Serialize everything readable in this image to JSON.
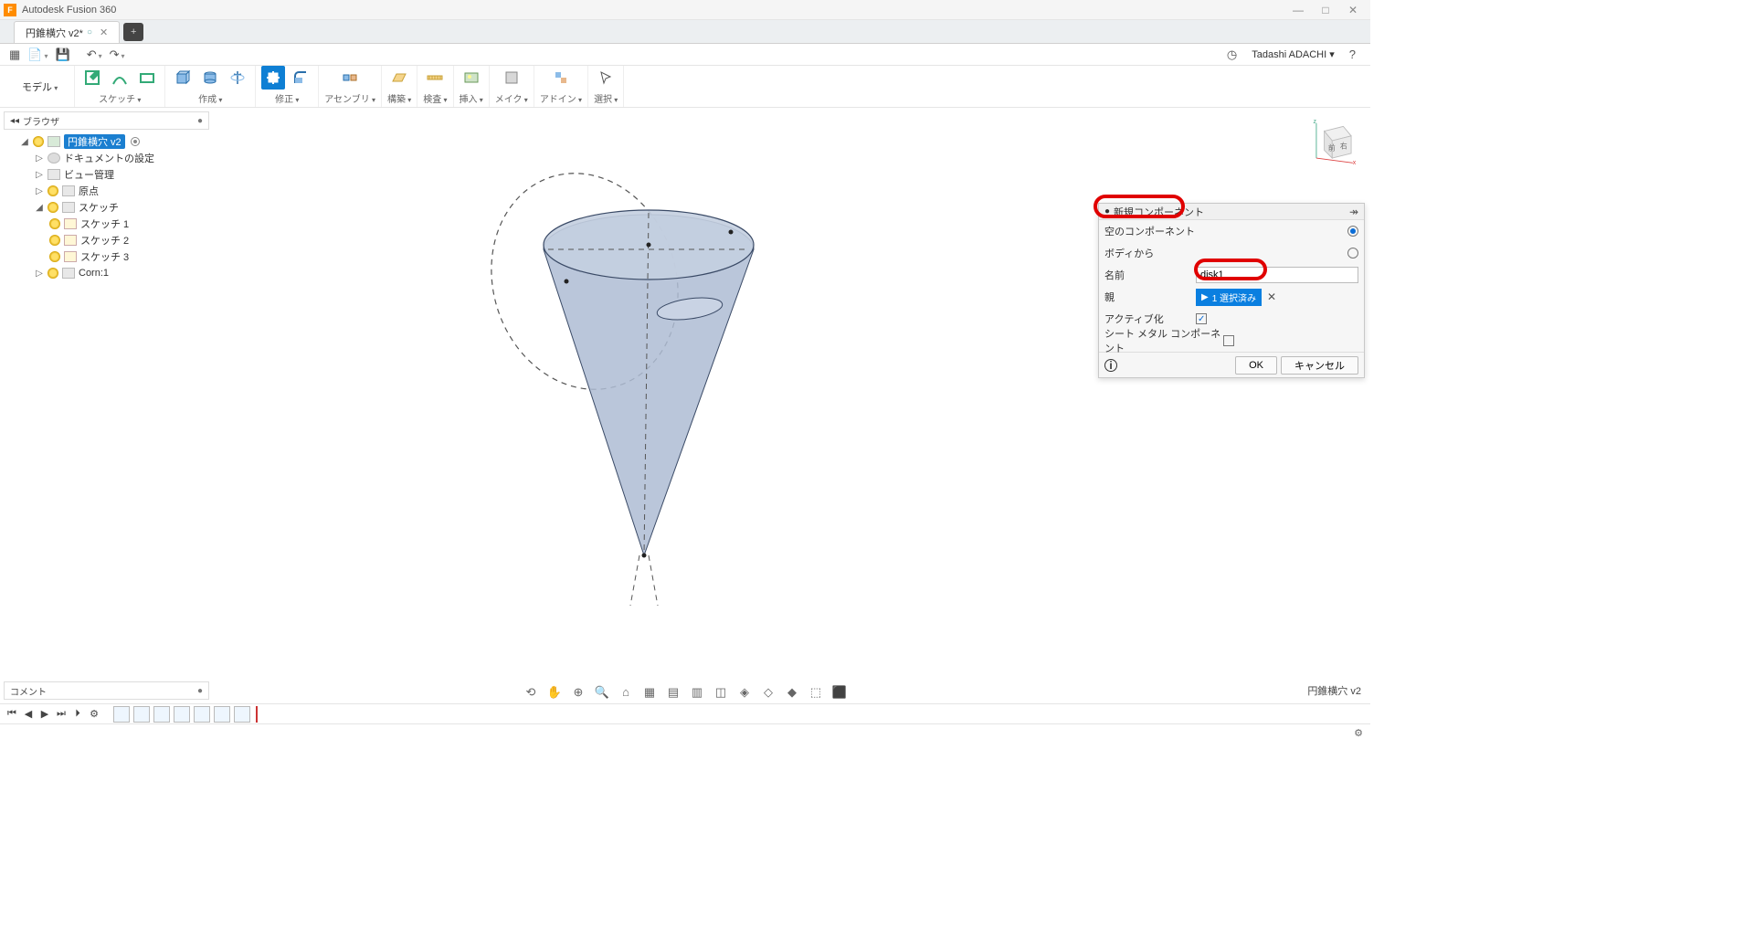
{
  "app": {
    "title": "Autodesk Fusion 360",
    "logo": "F"
  },
  "window_buttons": {
    "min": "—",
    "max": "□",
    "close": "✕"
  },
  "tabs": {
    "doc": "円錐横穴 v2*",
    "unsaved_mark": "○",
    "close": "✕",
    "new": "+"
  },
  "quick": {
    "user": "Tadashi ADACHI ▾",
    "help": "?"
  },
  "workspace": {
    "label": "モデル"
  },
  "toolbar_groups": {
    "sketch": "スケッチ",
    "create": "作成",
    "modify": "修正",
    "assembly": "アセンブリ",
    "construct": "構築",
    "inspect": "検査",
    "insert": "挿入",
    "make": "メイク",
    "addins": "アドイン",
    "select": "選択"
  },
  "browser": {
    "title": "ブラウザ",
    "collapse": "●",
    "nav": "◂◂",
    "root": "円錐横穴 v2",
    "doc_settings": "ドキュメントの設定",
    "views": "ビュー管理",
    "origin": "原点",
    "sketch_folder": "スケッチ",
    "sketches": [
      "スケッチ 1",
      "スケッチ 2",
      "スケッチ 3"
    ],
    "component": "Corn:1"
  },
  "dialog": {
    "title": "新規コンポーネント",
    "rows": {
      "empty": "空のコンポーネント",
      "from_body": "ボディから",
      "name": "名前",
      "parent": "親",
      "activate": "アクティブ化",
      "sheetmetal": "シート メタル コンポーネント"
    },
    "name_value": "disk1",
    "parent_chip": "1 選択済み",
    "parent_chip_icon": "▶",
    "clear": "✕",
    "pin": "↠",
    "info": "i",
    "ok": "OK",
    "cancel": "キャンセル"
  },
  "viewcube": {
    "front": "前",
    "right": "右"
  },
  "comment": {
    "label": "コメント",
    "collapse": "●"
  },
  "navtools": [
    "⟲",
    "✋",
    "⊕",
    "🔍",
    "⌂",
    "▦",
    "▤",
    "▥",
    "◫",
    "◈",
    "◇",
    "◆",
    "⬚",
    "⬛"
  ],
  "footer_doc": "円錐横穴 v2",
  "timeline": {
    "play": [
      "⏮",
      "◀",
      "▶",
      "⏭",
      "⏵"
    ],
    "gear": "⚙",
    "items": 7
  },
  "status_gear": "⚙"
}
